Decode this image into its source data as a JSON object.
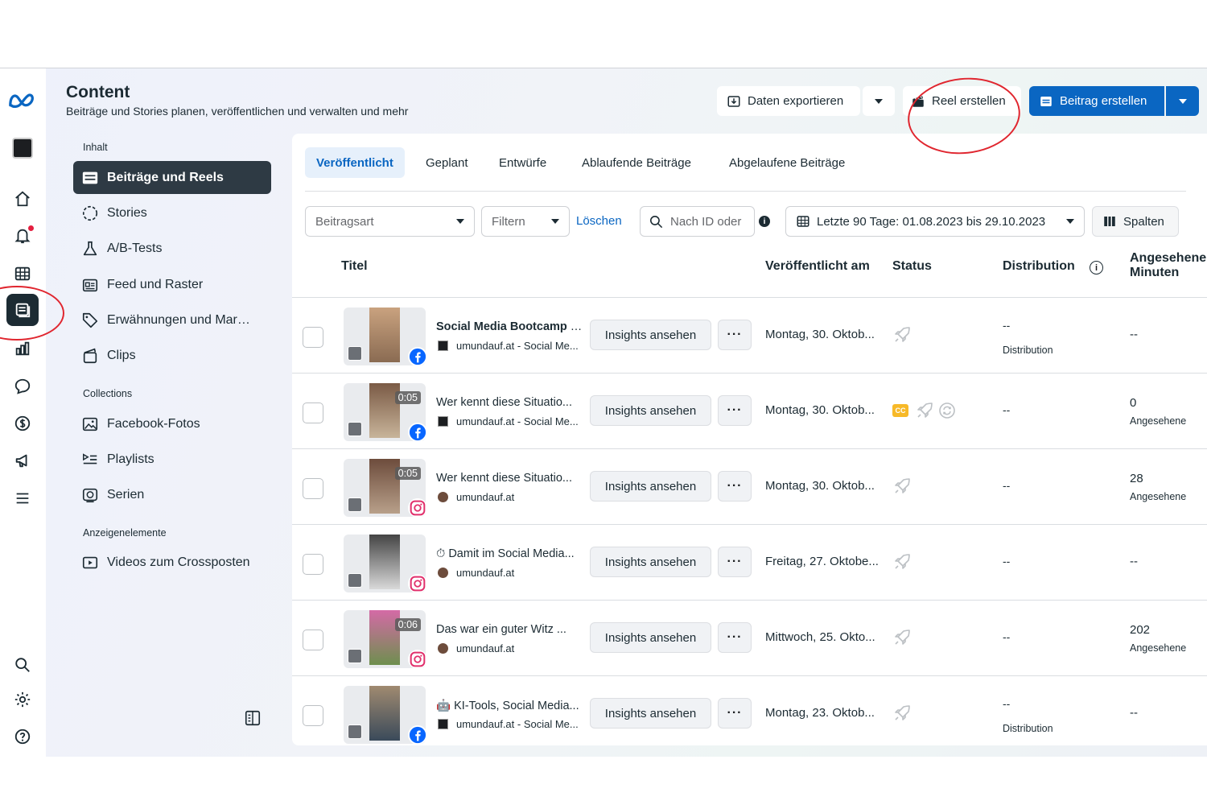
{
  "header": {
    "title": "Content",
    "subtitle": "Beiträge und Stories planen, veröffentlichen und verwalten und mehr"
  },
  "actions": {
    "export_label": "Daten exportieren",
    "reel_label": "Reel erstellen",
    "post_label": "Beitrag erstellen"
  },
  "sidebar": {
    "section_content": "Inhalt",
    "items": [
      {
        "label": "Beiträge und Reels"
      },
      {
        "label": "Stories"
      },
      {
        "label": "A/B-Tests"
      },
      {
        "label": "Feed und Raster"
      },
      {
        "label": "Erwähnungen und Mar…"
      },
      {
        "label": "Clips"
      }
    ],
    "section_collections": "Collections",
    "collections": [
      {
        "label": "Facebook-Fotos"
      },
      {
        "label": "Playlists"
      },
      {
        "label": "Serien"
      }
    ],
    "section_ads": "Anzeigenelemente",
    "ads": [
      {
        "label": "Videos zum Crossposten"
      }
    ]
  },
  "tabs": [
    {
      "label": "Veröffentlicht"
    },
    {
      "label": "Geplant"
    },
    {
      "label": "Entwürfe"
    },
    {
      "label": "Ablaufende Beiträge"
    },
    {
      "label": "Abgelaufene Beiträge"
    }
  ],
  "filters": {
    "post_type_placeholder": "Beitragsart",
    "filter_placeholder": "Filtern",
    "clear_label": "Löschen",
    "search_placeholder": "Nach ID oder",
    "date_range": "Letzte 90 Tage: 01.08.2023 bis 29.10.2023",
    "columns_label": "Spalten"
  },
  "table": {
    "headers": {
      "title": "Titel",
      "published": "Veröffentlicht am",
      "status": "Status",
      "distribution": "Distribution",
      "minutes_line1": "Angesehene",
      "minutes_line2": "Minuten"
    },
    "insights_label": "Insights ansehen",
    "more_label": "···",
    "rows": [
      {
        "title_bold": "Social Media Bootcamp",
        "title_rest": " be...",
        "account": "umundauf.at - Social Me...",
        "duration": "",
        "platform": "facebook",
        "date": "Montag, 30. Oktob...",
        "cc": false,
        "repost": false,
        "dist": "--",
        "dist_sub": "Distribution",
        "mins": "--",
        "mins_sub": ""
      },
      {
        "title_bold": "",
        "title_rest": "Wer kennt diese Situatio...",
        "account": "umundauf.at - Social Me...",
        "duration": "0:05",
        "platform": "facebook",
        "date": "Montag, 30. Oktob...",
        "cc": true,
        "repost": true,
        "dist": "--",
        "dist_sub": "",
        "mins": "0",
        "mins_sub": "Angesehene"
      },
      {
        "title_bold": "",
        "title_rest": "Wer kennt diese Situatio...",
        "account": "umundauf.at",
        "duration": "0:05",
        "platform": "instagram",
        "date": "Montag, 30. Oktob...",
        "cc": false,
        "repost": false,
        "dist": "--",
        "dist_sub": "",
        "mins": "28",
        "mins_sub": "Angesehene"
      },
      {
        "title_bold": "",
        "title_rest": "⏱ Damit im Social Media...",
        "account": "umundauf.at",
        "duration": "",
        "platform": "instagram",
        "date": "Freitag, 27. Oktobe...",
        "cc": false,
        "repost": false,
        "dist": "--",
        "dist_sub": "",
        "mins": "--",
        "mins_sub": ""
      },
      {
        "title_bold": "",
        "title_rest": "Das war ein guter Witz ...",
        "account": "umundauf.at",
        "duration": "0:06",
        "platform": "instagram",
        "date": "Mittwoch, 25. Okto...",
        "cc": false,
        "repost": false,
        "dist": "--",
        "dist_sub": "",
        "mins": "202",
        "mins_sub": "Angesehene"
      },
      {
        "title_bold": "",
        "title_rest": "🤖 KI-Tools, Social Media...",
        "account": "umundauf.at - Social Me...",
        "duration": "",
        "platform": "facebook",
        "date": "Montag, 23. Oktob...",
        "cc": false,
        "repost": false,
        "dist": "--",
        "dist_sub": "Distribution",
        "mins": "--",
        "mins_sub": ""
      }
    ]
  },
  "colors": {
    "primary": "#0a66c2",
    "dark": "#1c2b33",
    "annotation": "#e0262f"
  }
}
